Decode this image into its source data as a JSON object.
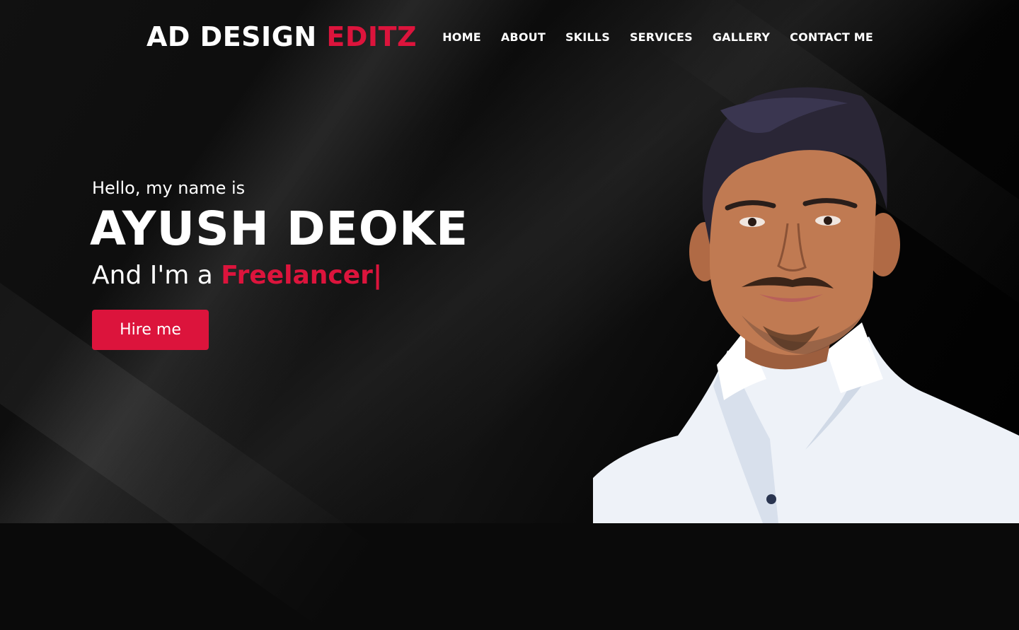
{
  "brand": {
    "name": "AD DESIGN",
    "accent": "EDITZ"
  },
  "nav": [
    {
      "label": "HOME"
    },
    {
      "label": "ABOUT"
    },
    {
      "label": "SKILLS"
    },
    {
      "label": "SERVICES"
    },
    {
      "label": "GALLERY"
    },
    {
      "label": "CONTACT ME"
    }
  ],
  "hero": {
    "greeting": "Hello, my name is",
    "name": "AYUSH DEOKE",
    "role_prefix": "And I'm a",
    "role_typed": "Freelancer",
    "cursor": "|",
    "cta_label": "Hire me"
  },
  "colors": {
    "accent": "#dc143c",
    "background": "#0a0a0a",
    "text": "#ffffff"
  }
}
